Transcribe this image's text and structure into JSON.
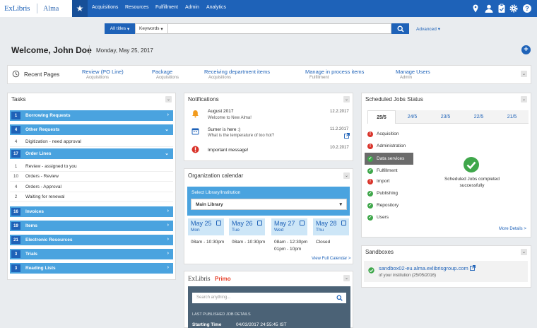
{
  "brand": {
    "company": "ExLibris",
    "product": "Alma"
  },
  "topnav": {
    "menu": [
      "Acquisitions",
      "Resources",
      "Fulfillment",
      "Admin",
      "Analytics"
    ],
    "icons": [
      "location-icon",
      "user-icon",
      "clipboard-icon",
      "gear-icon",
      "help-icon"
    ]
  },
  "search": {
    "scope": "All titles",
    "field": "Keywords",
    "value": "",
    "advanced": "Advanced"
  },
  "welcome": {
    "greeting": "Welcome, John Doe",
    "date": "Monday, May 25, 2017"
  },
  "recent": {
    "label": "Recent Pages",
    "items": [
      {
        "title": "Review (PO Line)",
        "sub": "Acquisitions"
      },
      {
        "title": "Package",
        "sub": "Acquisitions"
      },
      {
        "title": "Receiving department  items",
        "sub": "Acquisitions"
      },
      {
        "title": "Manage in process items",
        "sub": "Fulfillment"
      },
      {
        "title": "Manage Users",
        "sub": "Admin"
      }
    ]
  },
  "tasks": {
    "title": "Tasks",
    "rows": [
      {
        "count": "1",
        "label": "Borrowing Requests"
      },
      {
        "count": "4",
        "label": "Other Requests"
      },
      {
        "count": "4",
        "label": "Digitization - need approval"
      },
      {
        "count": "17",
        "label": "Order Lines"
      },
      {
        "count": "1",
        "label": "Review - assigned to you"
      },
      {
        "count": "10",
        "label": "Orders - Review"
      },
      {
        "count": "4",
        "label": "Orders - Approval"
      },
      {
        "count": "2",
        "label": "Waiting for renewal"
      },
      {
        "count": "16",
        "label": "Invoices"
      },
      {
        "count": "19",
        "label": "Items"
      },
      {
        "count": "21",
        "label": "Electronic Resources"
      },
      {
        "count": "3",
        "label": "Trials"
      },
      {
        "count": "3",
        "label": "Reading Lists"
      }
    ]
  },
  "notifications": {
    "title": "Notifications",
    "items": [
      {
        "title": "August 2017",
        "body": "Welcome to New Alma!",
        "date": "12.2.2017"
      },
      {
        "title": "Sumer is here :)",
        "body": "What is the temperature of too hot?",
        "date": "11.2.2017"
      },
      {
        "title": "Important message!",
        "body": "",
        "date": "10.2.2017"
      }
    ]
  },
  "calendar": {
    "title": "Organization calendar",
    "select_label": "Select Library/Institution",
    "selected": "Main Library",
    "days": [
      {
        "date": "May 25",
        "weekday": "Mon",
        "times": [
          "08am - 10:30pm"
        ]
      },
      {
        "date": "May 26",
        "weekday": "Tue",
        "times": [
          "08am - 10:30pm"
        ]
      },
      {
        "date": "May 27",
        "weekday": "Wed",
        "times": [
          "08am - 12:30pm",
          "01pm - 10pm"
        ]
      },
      {
        "date": "May 28",
        "weekday": "Thu",
        "times": [
          "Closed"
        ]
      }
    ],
    "view_full": "View Full Calendar >"
  },
  "primo": {
    "brand": "ExLibris",
    "product": "Primo",
    "search_placeholder": "Search anything...",
    "section": "LAST PUBLISHED JOB DETAILS",
    "start_label": "Starting Time",
    "start_value": "04/03/2017 24:55:45 IST"
  },
  "jobs": {
    "title": "Scheduled Jobs Status",
    "tabs": [
      "25/5",
      "24/5",
      "23/5",
      "22/5",
      "21/5"
    ],
    "items": [
      {
        "label": "Acquisition",
        "status": "error"
      },
      {
        "label": "Administration",
        "status": "error"
      },
      {
        "label": "Data services",
        "status": "ok"
      },
      {
        "label": "Fulfillment",
        "status": "ok"
      },
      {
        "label": "Import",
        "status": "error"
      },
      {
        "label": "Publishing",
        "status": "ok"
      },
      {
        "label": "Repository",
        "status": "ok"
      },
      {
        "label": "Users",
        "status": "ok"
      }
    ],
    "summary": "Scheduled Jobs completed successfully",
    "more": "More Details >"
  },
  "sandboxes": {
    "title": "Sandboxes",
    "url": "sandbox02-eu.alma.exlibrisgroup.com",
    "desc": "of your institution (25/05/2016)"
  },
  "colors": {
    "primary": "#1e62b8",
    "task_row": "#4aa3df",
    "error": "#d9342b",
    "success": "#3fa74b"
  }
}
